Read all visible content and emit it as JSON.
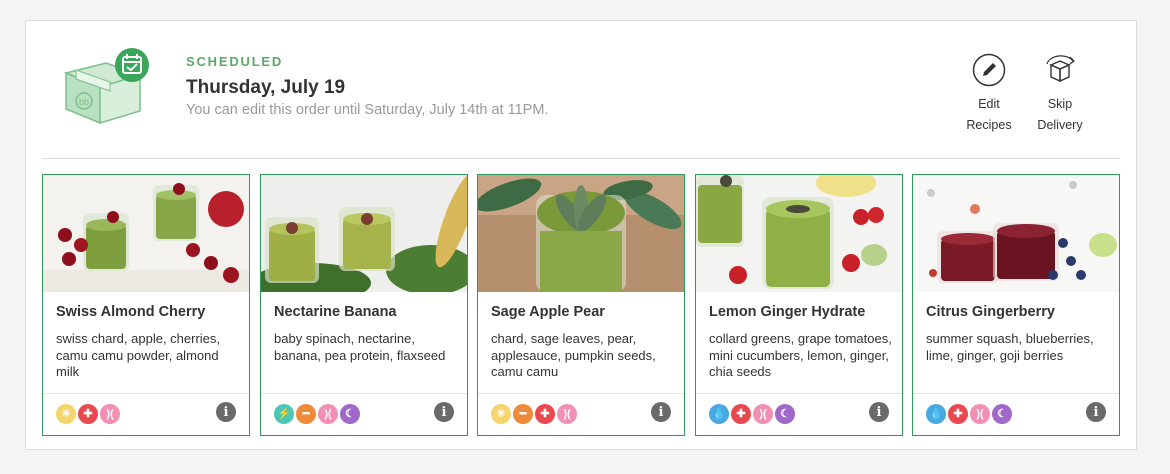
{
  "order": {
    "status": "SCHEDULED",
    "date": "Thursday, July 19",
    "edit_note": "You can edit this order until Saturday, July 14th at 11PM."
  },
  "actions": {
    "edit_line1": "Edit",
    "edit_line2": "Recipes",
    "skip_line1": "Skip",
    "skip_line2": "Delivery"
  },
  "badge_colors": {
    "sun": "#f5d56b",
    "cross": "#e8484e",
    "waist": "#f28fb3",
    "bolt": "#4bc7b8",
    "dumbbell": "#ef8a3a",
    "moon": "#a068c8",
    "drop": "#4aa8e0"
  },
  "accent": "#5ba86b",
  "card_border": "#2e9a5a",
  "recipes": [
    {
      "name": "Swiss Almond Cherry",
      "ingredients": "swiss chard, apple, cherries, camu camu powder, almond milk",
      "badges": [
        "sun-icon",
        "cross-icon",
        "waist-icon"
      ]
    },
    {
      "name": "Nectarine Banana",
      "ingredients": "baby spinach, nectarine, banana, pea protein, flaxseed",
      "badges": [
        "bolt-icon",
        "dumbbell-icon",
        "waist-icon",
        "moon-icon"
      ]
    },
    {
      "name": "Sage Apple Pear",
      "ingredients": "chard, sage leaves, pear, applesauce, pumpkin seeds, camu camu",
      "badges": [
        "sun-icon",
        "dumbbell-icon",
        "cross-icon",
        "waist-icon"
      ]
    },
    {
      "name": "Lemon Ginger Hydrate",
      "ingredients": "collard greens, grape tomatoes, mini cucumbers, lemon, ginger, chia seeds",
      "badges": [
        "drop-icon",
        "cross-icon",
        "waist-icon",
        "moon-icon"
      ]
    },
    {
      "name": "Citrus Gingerberry",
      "ingredients": "summer squash, blueberries, lime, ginger, goji berries",
      "badges": [
        "drop-icon",
        "cross-icon",
        "waist-icon",
        "moon-icon"
      ]
    }
  ]
}
